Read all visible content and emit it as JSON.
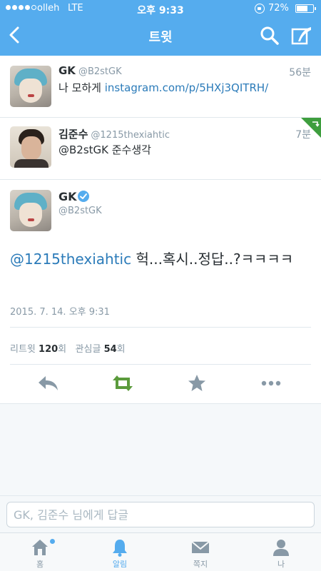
{
  "status_bar": {
    "carrier": "olleh",
    "network": "LTE",
    "time": "오후 9:33",
    "battery_pct": "72%",
    "battery_level": 0.72
  },
  "nav": {
    "title": "트윗"
  },
  "tweets": [
    {
      "name": "GK",
      "handle": "@B2stGK",
      "time": "56분",
      "text_prefix": "나 모하게 ",
      "link": "instagram.com/p/5HXj3QITRH/"
    },
    {
      "name": "김준수",
      "handle": "@1215thexiahtic",
      "time": "7분",
      "text": "@B2stGK 준수생각"
    }
  ],
  "detail": {
    "name": "GK",
    "handle": "@B2stGK",
    "mention": "@1215thexiahtic",
    "text": " 헉...혹시..정답..?ㅋㅋㅋㅋ",
    "date": "2015. 7. 14. 오후 9:31",
    "retweet_label": "리트윗",
    "retweet_count": "120",
    "count_unit": "회",
    "favorite_label": "관심글",
    "favorite_count": "54"
  },
  "reply": {
    "placeholder": "GK, 김준수 님에게 답글"
  },
  "tabs": [
    {
      "label": "홈",
      "icon": "home-icon"
    },
    {
      "label": "알림",
      "icon": "bell-icon"
    },
    {
      "label": "쪽지",
      "icon": "envelope-icon"
    },
    {
      "label": "나",
      "icon": "person-icon"
    }
  ],
  "colors": {
    "brand": "#55acee",
    "link": "#2b7bb9",
    "retweet": "#5b9b3c",
    "text": "#292f33",
    "muted": "#8899a6"
  }
}
